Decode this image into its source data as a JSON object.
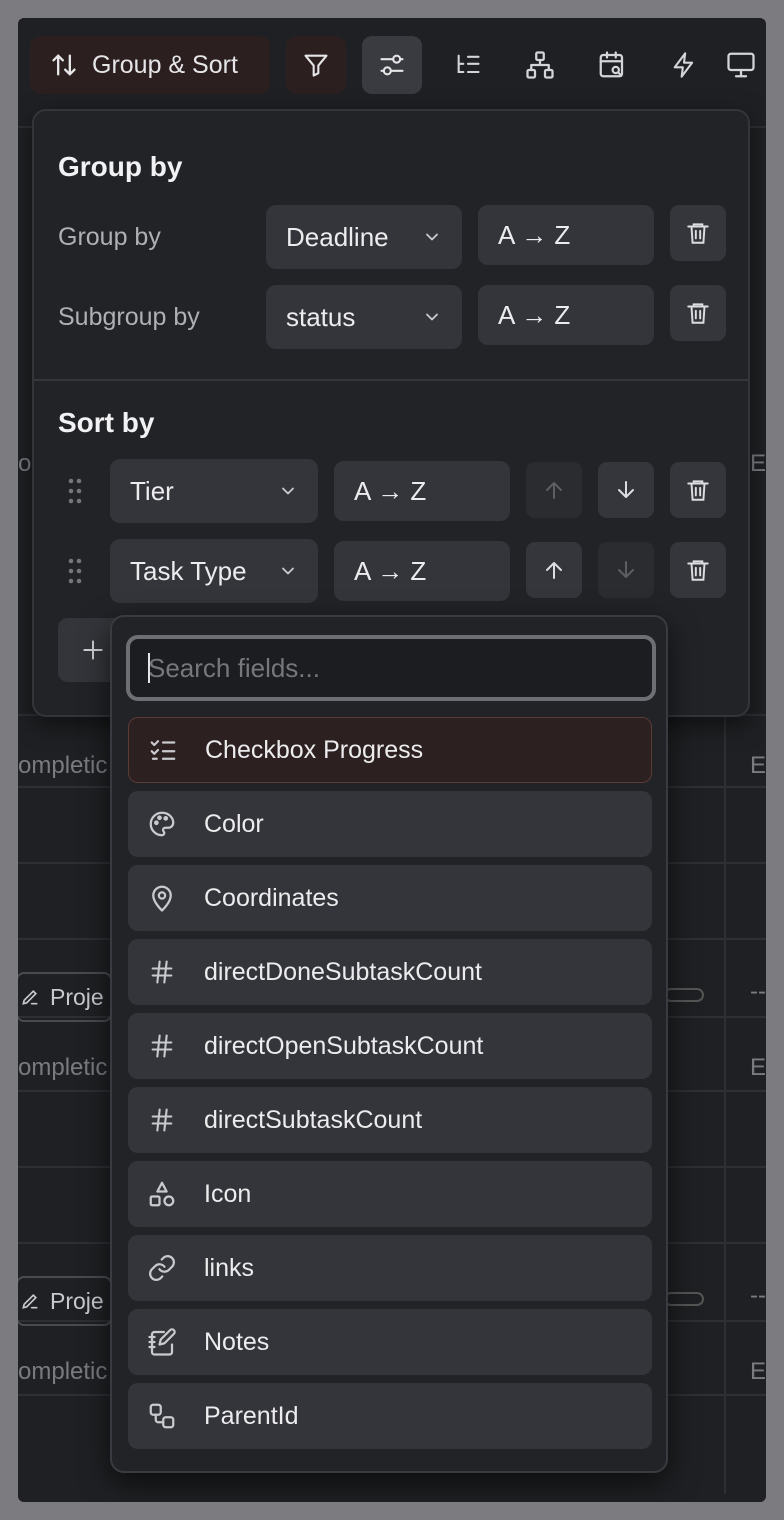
{
  "toolbar": {
    "group_sort_label": "Group & Sort"
  },
  "background": {
    "completion_text": "ompletic",
    "project_text": "Proje",
    "e_text": "E",
    "dash_text": "--",
    "o_text": "o"
  },
  "group_by": {
    "title": "Group by",
    "rows": [
      {
        "label": "Group by",
        "field": "Deadline",
        "direction": "A → Z"
      },
      {
        "label": "Subgroup by",
        "field": "status",
        "direction": "A → Z"
      }
    ]
  },
  "sort_by": {
    "title": "Sort by",
    "rows": [
      {
        "field": "Tier",
        "direction": "A → Z"
      },
      {
        "field": "Task Type",
        "direction": "A → Z"
      }
    ]
  },
  "picker": {
    "placeholder": "Search fields...",
    "fields": [
      {
        "label": "Checkbox Progress",
        "icon": "list-checks-icon"
      },
      {
        "label": "Color",
        "icon": "palette-icon"
      },
      {
        "label": "Coordinates",
        "icon": "map-pin-icon"
      },
      {
        "label": "directDoneSubtaskCount",
        "icon": "hash-icon"
      },
      {
        "label": "directOpenSubtaskCount",
        "icon": "hash-icon"
      },
      {
        "label": "directSubtaskCount",
        "icon": "hash-icon"
      },
      {
        "label": "Icon",
        "icon": "shapes-icon"
      },
      {
        "label": "links",
        "icon": "link-icon"
      },
      {
        "label": "Notes",
        "icon": "notebook-pen-icon"
      },
      {
        "label": "ParentId",
        "icon": "workflow-icon"
      }
    ]
  },
  "colors": {
    "accent_bg": "#2b1f1f",
    "panel_bg": "#222327",
    "control_bg": "#34353a"
  }
}
